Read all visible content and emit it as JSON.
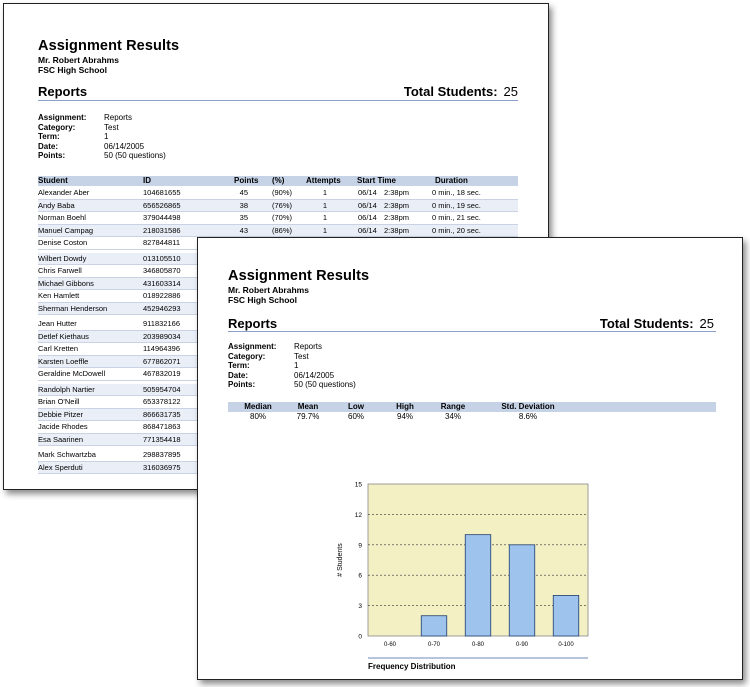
{
  "report1": {
    "title": "Assignment Results",
    "teacher": "Mr. Robert Abrahms",
    "school": "FSC High School",
    "section": "Reports",
    "total_label": "Total Students:",
    "total_value": "25",
    "info": [
      {
        "label": "Assignment:",
        "value": "Reports"
      },
      {
        "label": "Category:",
        "value": "Test"
      },
      {
        "label": "Term:",
        "value": "1"
      },
      {
        "label": "Date:",
        "value": "06/14/2005"
      },
      {
        "label": "Points:",
        "value": "50  (50 questions)"
      }
    ],
    "table": {
      "headers": {
        "student": "Student",
        "id": "ID",
        "points": "Points",
        "pct": "(%)",
        "attempts": "Attempts",
        "start": "Start Time",
        "duration": "Duration"
      },
      "rows": [
        {
          "student": "Alexander Aber",
          "id": "104681655",
          "points": "45",
          "pct": "(90%)",
          "attempts": "1",
          "date": "06/14",
          "time": "2:38pm",
          "duration": "0 min., 18 sec."
        },
        {
          "student": "Andy Baba",
          "id": "656526865",
          "points": "38",
          "pct": "(76%)",
          "attempts": "1",
          "date": "06/14",
          "time": "2:38pm",
          "duration": "0 min., 19 sec."
        },
        {
          "student": "Norman Boehl",
          "id": "379044498",
          "points": "35",
          "pct": "(70%)",
          "attempts": "1",
          "date": "06/14",
          "time": "2:38pm",
          "duration": "0 min., 21 sec."
        },
        {
          "student": "Manuel Campag",
          "id": "218031586",
          "points": "43",
          "pct": "(86%)",
          "attempts": "1",
          "date": "06/14",
          "time": "2:38pm",
          "duration": "0 min., 20 sec."
        },
        {
          "student": "Denise Coston",
          "id": "827844811"
        },
        {
          "student": "Wilbert Dowdy",
          "id": "013105510"
        },
        {
          "student": "Chris Farwell",
          "id": "346805870"
        },
        {
          "student": "Michael Gibbons",
          "id": "431603314"
        },
        {
          "student": "Ken Hamlett",
          "id": "018922886"
        },
        {
          "student": "Sherman Henderson",
          "id": "452946293"
        },
        {
          "student": "Jean Hutter",
          "id": "911832166"
        },
        {
          "student": "Detlef Kiethaus",
          "id": "203989034"
        },
        {
          "student": "Carl Kretten",
          "id": "114964396"
        },
        {
          "student": "Karsten Loeffle",
          "id": "677862071"
        },
        {
          "student": "Geraldine McDowell",
          "id": "467832019"
        },
        {
          "student": "Randolph Nartier",
          "id": "505954704"
        },
        {
          "student": "Brian O'Neill",
          "id": "653378122"
        },
        {
          "student": "Debbie Pitzer",
          "id": "866631735"
        },
        {
          "student": "Jacide Rhodes",
          "id": "868471863"
        },
        {
          "student": "Esa Saarinen",
          "id": "771354418"
        },
        {
          "student": "Mark Schwartzba",
          "id": "298837895"
        },
        {
          "student": "Alex Sperduti",
          "id": "316036975"
        }
      ]
    }
  },
  "report2": {
    "title": "Assignment Results",
    "teacher": "Mr. Robert Abrahms",
    "school": "FSC High School",
    "section": "Reports",
    "total_label": "Total Students:",
    "total_value": "25",
    "info": [
      {
        "label": "Assignment:",
        "value": "Reports"
      },
      {
        "label": "Category:",
        "value": "Test"
      },
      {
        "label": "Term:",
        "value": "1"
      },
      {
        "label": "Date:",
        "value": "06/14/2005"
      },
      {
        "label": "Points:",
        "value": "50  (50 questions)"
      }
    ],
    "stats": {
      "headers": [
        "Median",
        "Mean",
        "Low",
        "High",
        "Range",
        "Std. Deviation"
      ],
      "values": [
        "80%",
        "79.7%",
        "60%",
        "94%",
        "34%",
        "8.6%"
      ]
    }
  },
  "chart_data": {
    "type": "bar",
    "title": "",
    "xlabel": "Frequency Distribution",
    "ylabel": "# Students",
    "categories": [
      "0-60",
      "0-70",
      "0-80",
      "0-90",
      "0-100"
    ],
    "values": [
      0,
      2,
      10,
      9,
      4
    ],
    "ylim": [
      0,
      15
    ],
    "yticks": [
      0,
      3,
      6,
      9,
      12,
      15
    ],
    "grid": true,
    "colors": {
      "plot_bg": "#f3f1c4",
      "bar": "#9ec4ee",
      "bar_edge": "#1f3c6b"
    }
  }
}
